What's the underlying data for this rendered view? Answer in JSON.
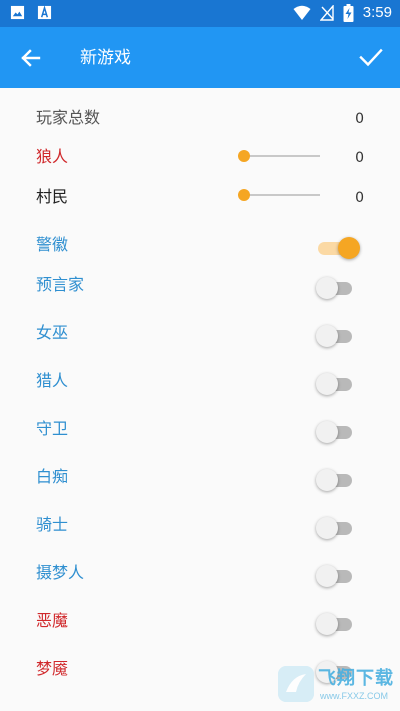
{
  "status_bar": {
    "time": "3:59"
  },
  "app_bar": {
    "title": "新游戏"
  },
  "rows": {
    "total_players": {
      "label": "玩家总数",
      "value": "0"
    },
    "werewolf": {
      "label": "狼人",
      "value": "0",
      "slider_level": 0
    },
    "villager": {
      "label": "村民",
      "value": "0",
      "slider_level": 0
    }
  },
  "toggles": [
    {
      "label": "警徽",
      "on": true
    },
    {
      "label": "预言家",
      "on": false
    },
    {
      "label": "女巫",
      "on": false
    },
    {
      "label": "猎人",
      "on": false
    },
    {
      "label": "守卫",
      "on": false
    },
    {
      "label": "白痴",
      "on": false
    },
    {
      "label": "骑士",
      "on": false
    },
    {
      "label": "摄梦人",
      "on": false
    },
    {
      "label": "恶魔",
      "on": false
    },
    {
      "label": "梦魇",
      "on": false
    }
  ],
  "watermark": {
    "name": "飞翔下载",
    "url": "www.FXXZ.COM"
  },
  "colors": {
    "status_bar": "#1976d2",
    "app_bar": "#2196f3",
    "accent": "#f5a623",
    "role_blue": "#2f8fd0",
    "role_red": "#d0282b",
    "text_gray": "#555555",
    "text_black": "#222222"
  }
}
